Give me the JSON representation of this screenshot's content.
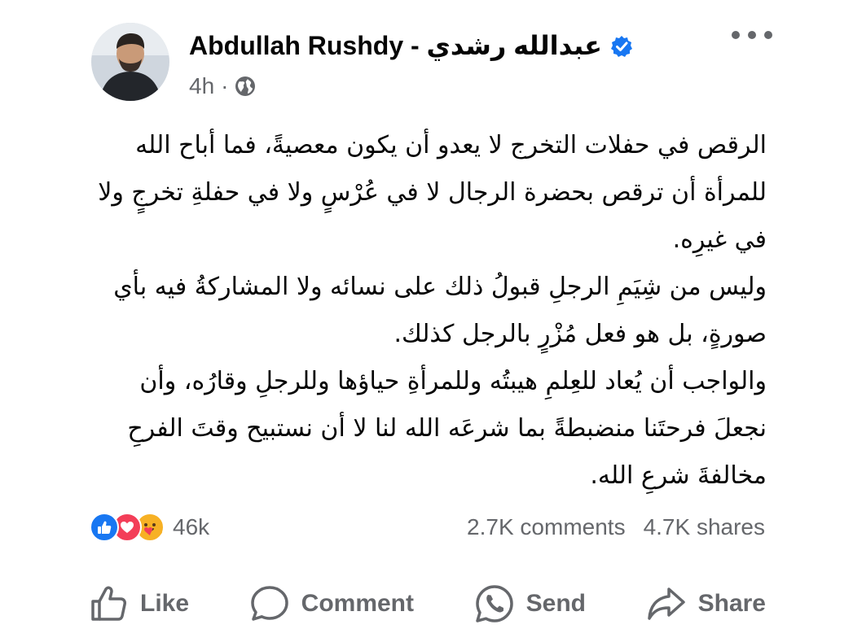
{
  "post": {
    "author": "Abdullah Rushdy - عبدالله رشدي",
    "verified": true,
    "time": "4h",
    "audience_icon": "globe-icon",
    "body": [
      "الرقص في حفلات التخرج لا يعدو أن يكون معصيةً، فما أباح الله للمرأة أن ترقص بحضرة الرجال لا في عُرْسٍ ولا في حفلةِ تخرجٍ ولا في غيرِه.",
      "وليس من شِيَمِ الرجلِ قبولُ ذلك على نسائه ولا المشاركةُ فيه بأي صورةٍ، بل هو فعل مُزْرٍ بالرجل كذلك.",
      "والواجب أن يُعاد للعِلمِ هيبتُه وللمرأةِ حياؤها وللرجلِ وقارُه، وأن نجعلَ فرحتَنا منضبطةً بما شرعَه الله لنا لا أن نستبيح وقتَ الفرحِ مخالفةَ شرعِ الله."
    ]
  },
  "reactions": {
    "types": [
      "like",
      "love",
      "care"
    ],
    "count": "46k"
  },
  "stats": {
    "comments": "2.7K comments",
    "shares": "4.7K shares"
  },
  "actions": {
    "like": "Like",
    "comment": "Comment",
    "send": "Send",
    "share": "Share"
  },
  "colors": {
    "facebook_blue": "#1877f2",
    "love_red": "#f33e58",
    "care_yellow": "#f7b125",
    "secondary_text": "#65676b"
  }
}
